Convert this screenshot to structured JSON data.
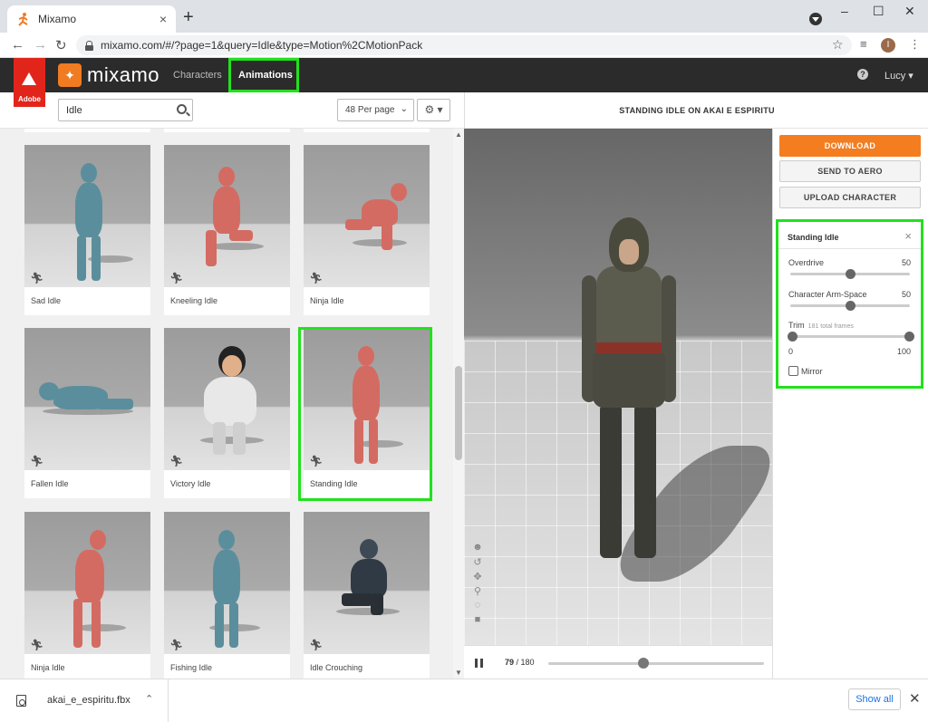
{
  "browser": {
    "tab_title": "Mixamo",
    "tab_close": "×",
    "new_tab": "+",
    "url": "mixamo.com/#/?page=1&query=Idle&type=Motion%2CMotionPack",
    "profile_initial": "I",
    "win_minimize": "–",
    "win_maximize": "☐",
    "win_close": "✕"
  },
  "app": {
    "adobe_label": "Adobe",
    "brand": "mixamo",
    "nav": [
      {
        "label": "Characters"
      },
      {
        "label": "Animations",
        "active": true
      }
    ],
    "help": "?",
    "user": "Lucy ▾"
  },
  "toolbar": {
    "search_value": "Idle",
    "per_page": "48 Per page",
    "settings_icon": "⚙ ▾"
  },
  "animations": [
    {
      "name": "Sad Idle",
      "color": "blue"
    },
    {
      "name": "Kneeling Idle",
      "color": "red"
    },
    {
      "name": "Ninja Idle",
      "color": "red"
    },
    {
      "name": "Fallen Idle",
      "color": "blue"
    },
    {
      "name": "Victory Idle",
      "color": "character"
    },
    {
      "name": "Standing Idle",
      "color": "red",
      "selected": true
    },
    {
      "name": "Ninja Idle",
      "color": "red"
    },
    {
      "name": "Fishing Idle",
      "color": "blue"
    },
    {
      "name": "Idle Crouching",
      "color": "character"
    }
  ],
  "preview": {
    "title": "STANDING IDLE ON AKAI E ESPIRITU",
    "current_frame": "79",
    "total_frames": "/ 180",
    "progress": 0.44
  },
  "actions": {
    "download": "DOWNLOAD",
    "send_to_aero": "SEND TO AERO",
    "upload_character": "UPLOAD CHARACTER"
  },
  "settings_panel": {
    "title": "Standing Idle",
    "close": "×",
    "overdrive_label": "Overdrive",
    "overdrive_value": "50",
    "overdrive_fraction": 0.5,
    "arm_space_label": "Character Arm-Space",
    "arm_space_value": "50",
    "arm_space_fraction": 0.5,
    "trim_label": "Trim",
    "trim_sub": "181 total frames",
    "trim_min": "0",
    "trim_max": "100",
    "mirror_label": "Mirror"
  },
  "downloads": {
    "file": "akai_e_espiritu.fbx",
    "show_all": "Show all",
    "close": "✕"
  },
  "colors": {
    "highlight": "#22e01e",
    "download_orange": "#f47d20",
    "adobe_red": "#e1251b",
    "nav_bg": "#2b2b2b"
  }
}
